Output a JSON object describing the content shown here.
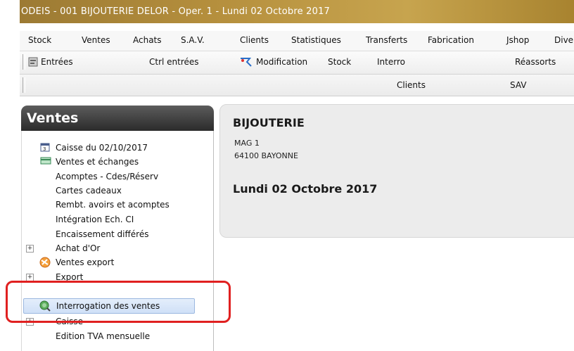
{
  "window": {
    "title": "ODEIS - 001 BIJOUTERIE DELOR - Oper. 1 - Lundi 02 Octobre 2017"
  },
  "menubar": {
    "items": [
      "Stock",
      "Ventes",
      "Achats",
      "S.A.V.",
      "Clients",
      "Statistiques",
      "Transferts",
      "Fabrication",
      "Jshop",
      "Dive"
    ]
  },
  "toolbar": {
    "entrees": "Entrées",
    "ctrl_entrees": "Ctrl entrées",
    "modification": "Modification",
    "stock": "Stock",
    "interro": "Interro",
    "reassorts": "Réassorts"
  },
  "toolbar2": {
    "clients": "Clients",
    "sav": "SAV"
  },
  "sidebar": {
    "title": "Ventes",
    "items": [
      "Caisse du 02/10/2017",
      "Ventes et échanges",
      "Acomptes - Cdes/Réserv",
      "Cartes cadeaux",
      "Rembt. avoirs et acomptes",
      "Intégration Ech. CI",
      "Encaissement différés",
      "Achat d'Or",
      "Ventes export",
      "Export",
      "Interrogation des ventes",
      "Caisse",
      "Edition TVA mensuelle"
    ]
  },
  "store": {
    "name": "BIJOUTERIE",
    "line1": "MAG 1",
    "line2": "64100 BAYONNE",
    "date": "Lundi 02 Octobre 2017"
  },
  "colors": {
    "highlight": "#e02020",
    "title_bar": "#b58f3d"
  }
}
